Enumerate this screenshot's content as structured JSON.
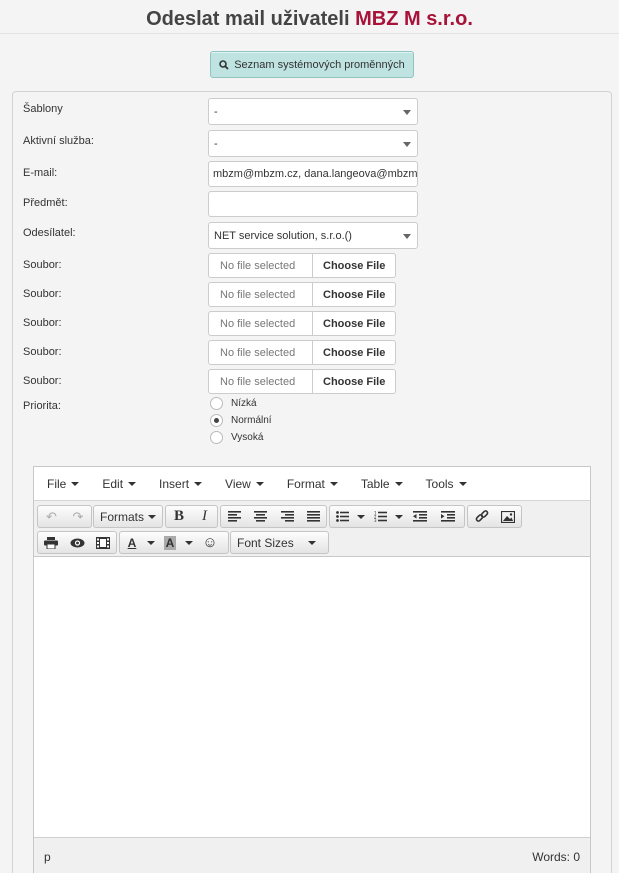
{
  "header": {
    "title_prefix": "Odeslat mail uživateli",
    "title_company": "MBZ M s.r.o."
  },
  "vars_button": {
    "label": "Seznam systémových proměnných",
    "icon": "search-icon"
  },
  "form": {
    "templates": {
      "label": "Šablony",
      "value": "-"
    },
    "active_service": {
      "label": "Aktivní služba:",
      "value": "-"
    },
    "email": {
      "label": "E-mail:",
      "value": "mbzm@mbzm.cz, dana.langeova@mbzm."
    },
    "subject": {
      "label": "Předmět:",
      "value": ""
    },
    "sender": {
      "label": "Odesílatel:",
      "value": "NET service solution, s.r.o.()"
    },
    "files": [
      {
        "label": "Soubor:",
        "status": "No file selected",
        "button": "Choose File"
      },
      {
        "label": "Soubor:",
        "status": "No file selected",
        "button": "Choose File"
      },
      {
        "label": "Soubor:",
        "status": "No file selected",
        "button": "Choose File"
      },
      {
        "label": "Soubor:",
        "status": "No file selected",
        "button": "Choose File"
      },
      {
        "label": "Soubor:",
        "status": "No file selected",
        "button": "Choose File"
      }
    ],
    "priority": {
      "label": "Priorita:",
      "options": [
        "Nízká",
        "Normální",
        "Vysoká"
      ],
      "selected": "Normální"
    }
  },
  "editor": {
    "menu": [
      "File",
      "Edit",
      "Insert",
      "View",
      "Format",
      "Table",
      "Tools"
    ],
    "formats_label": "Formats",
    "font_sizes_label": "Font Sizes",
    "status_path": "p",
    "word_count": "Words: 0"
  }
}
